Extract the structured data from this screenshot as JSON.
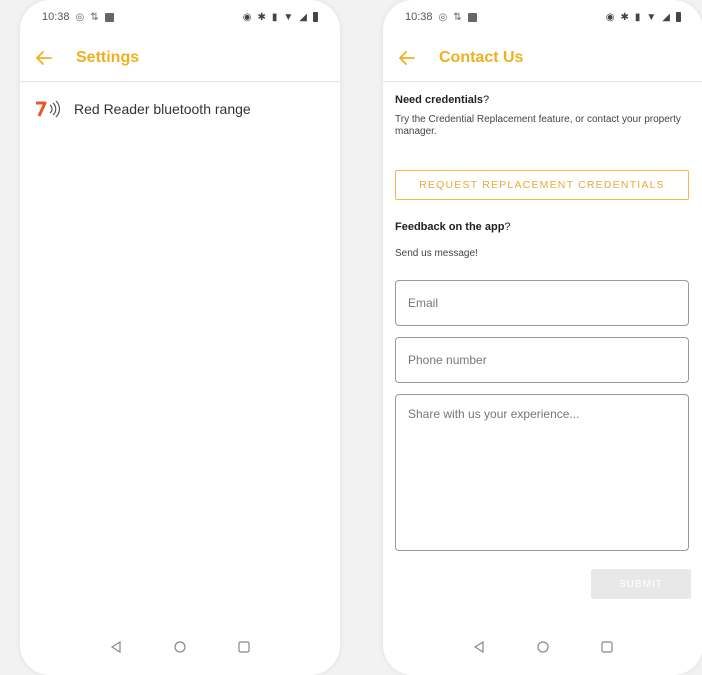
{
  "colors": {
    "accent": "#f0b01e",
    "text": "#333333",
    "divider": "#e3e3e3"
  },
  "status_bar": {
    "time": "10:38",
    "icons": [
      "a-icon",
      "data-icon",
      "image-icon",
      "alarm-icon",
      "bluetooth-icon",
      "vibrate-icon",
      "wifi-icon",
      "signal-icon",
      "battery-icon"
    ]
  },
  "settings_screen": {
    "title": "Settings",
    "items": [
      {
        "label": "Red Reader bluetooth range",
        "icon": "red-reader-logo-icon"
      }
    ]
  },
  "contact_screen": {
    "title": "Contact Us",
    "credentials_heading": "Need credentials",
    "credentials_heading_suffix": "?",
    "credentials_text": "Try the Credential Replacement feature, or contact your property manager.",
    "request_button": "REQUEST REPLACEMENT CREDENTIALS",
    "feedback_heading": "Feedback on the app",
    "feedback_heading_suffix": "?",
    "feedback_text": "Send us message!",
    "email_placeholder": "Email",
    "phone_placeholder": "Phone number",
    "experience_placeholder": "Share with us your experience...",
    "submit_button": "SUBMIT"
  },
  "nav_bar": {
    "buttons": [
      "back-triangle-icon",
      "home-circle-icon",
      "recents-square-icon"
    ]
  }
}
